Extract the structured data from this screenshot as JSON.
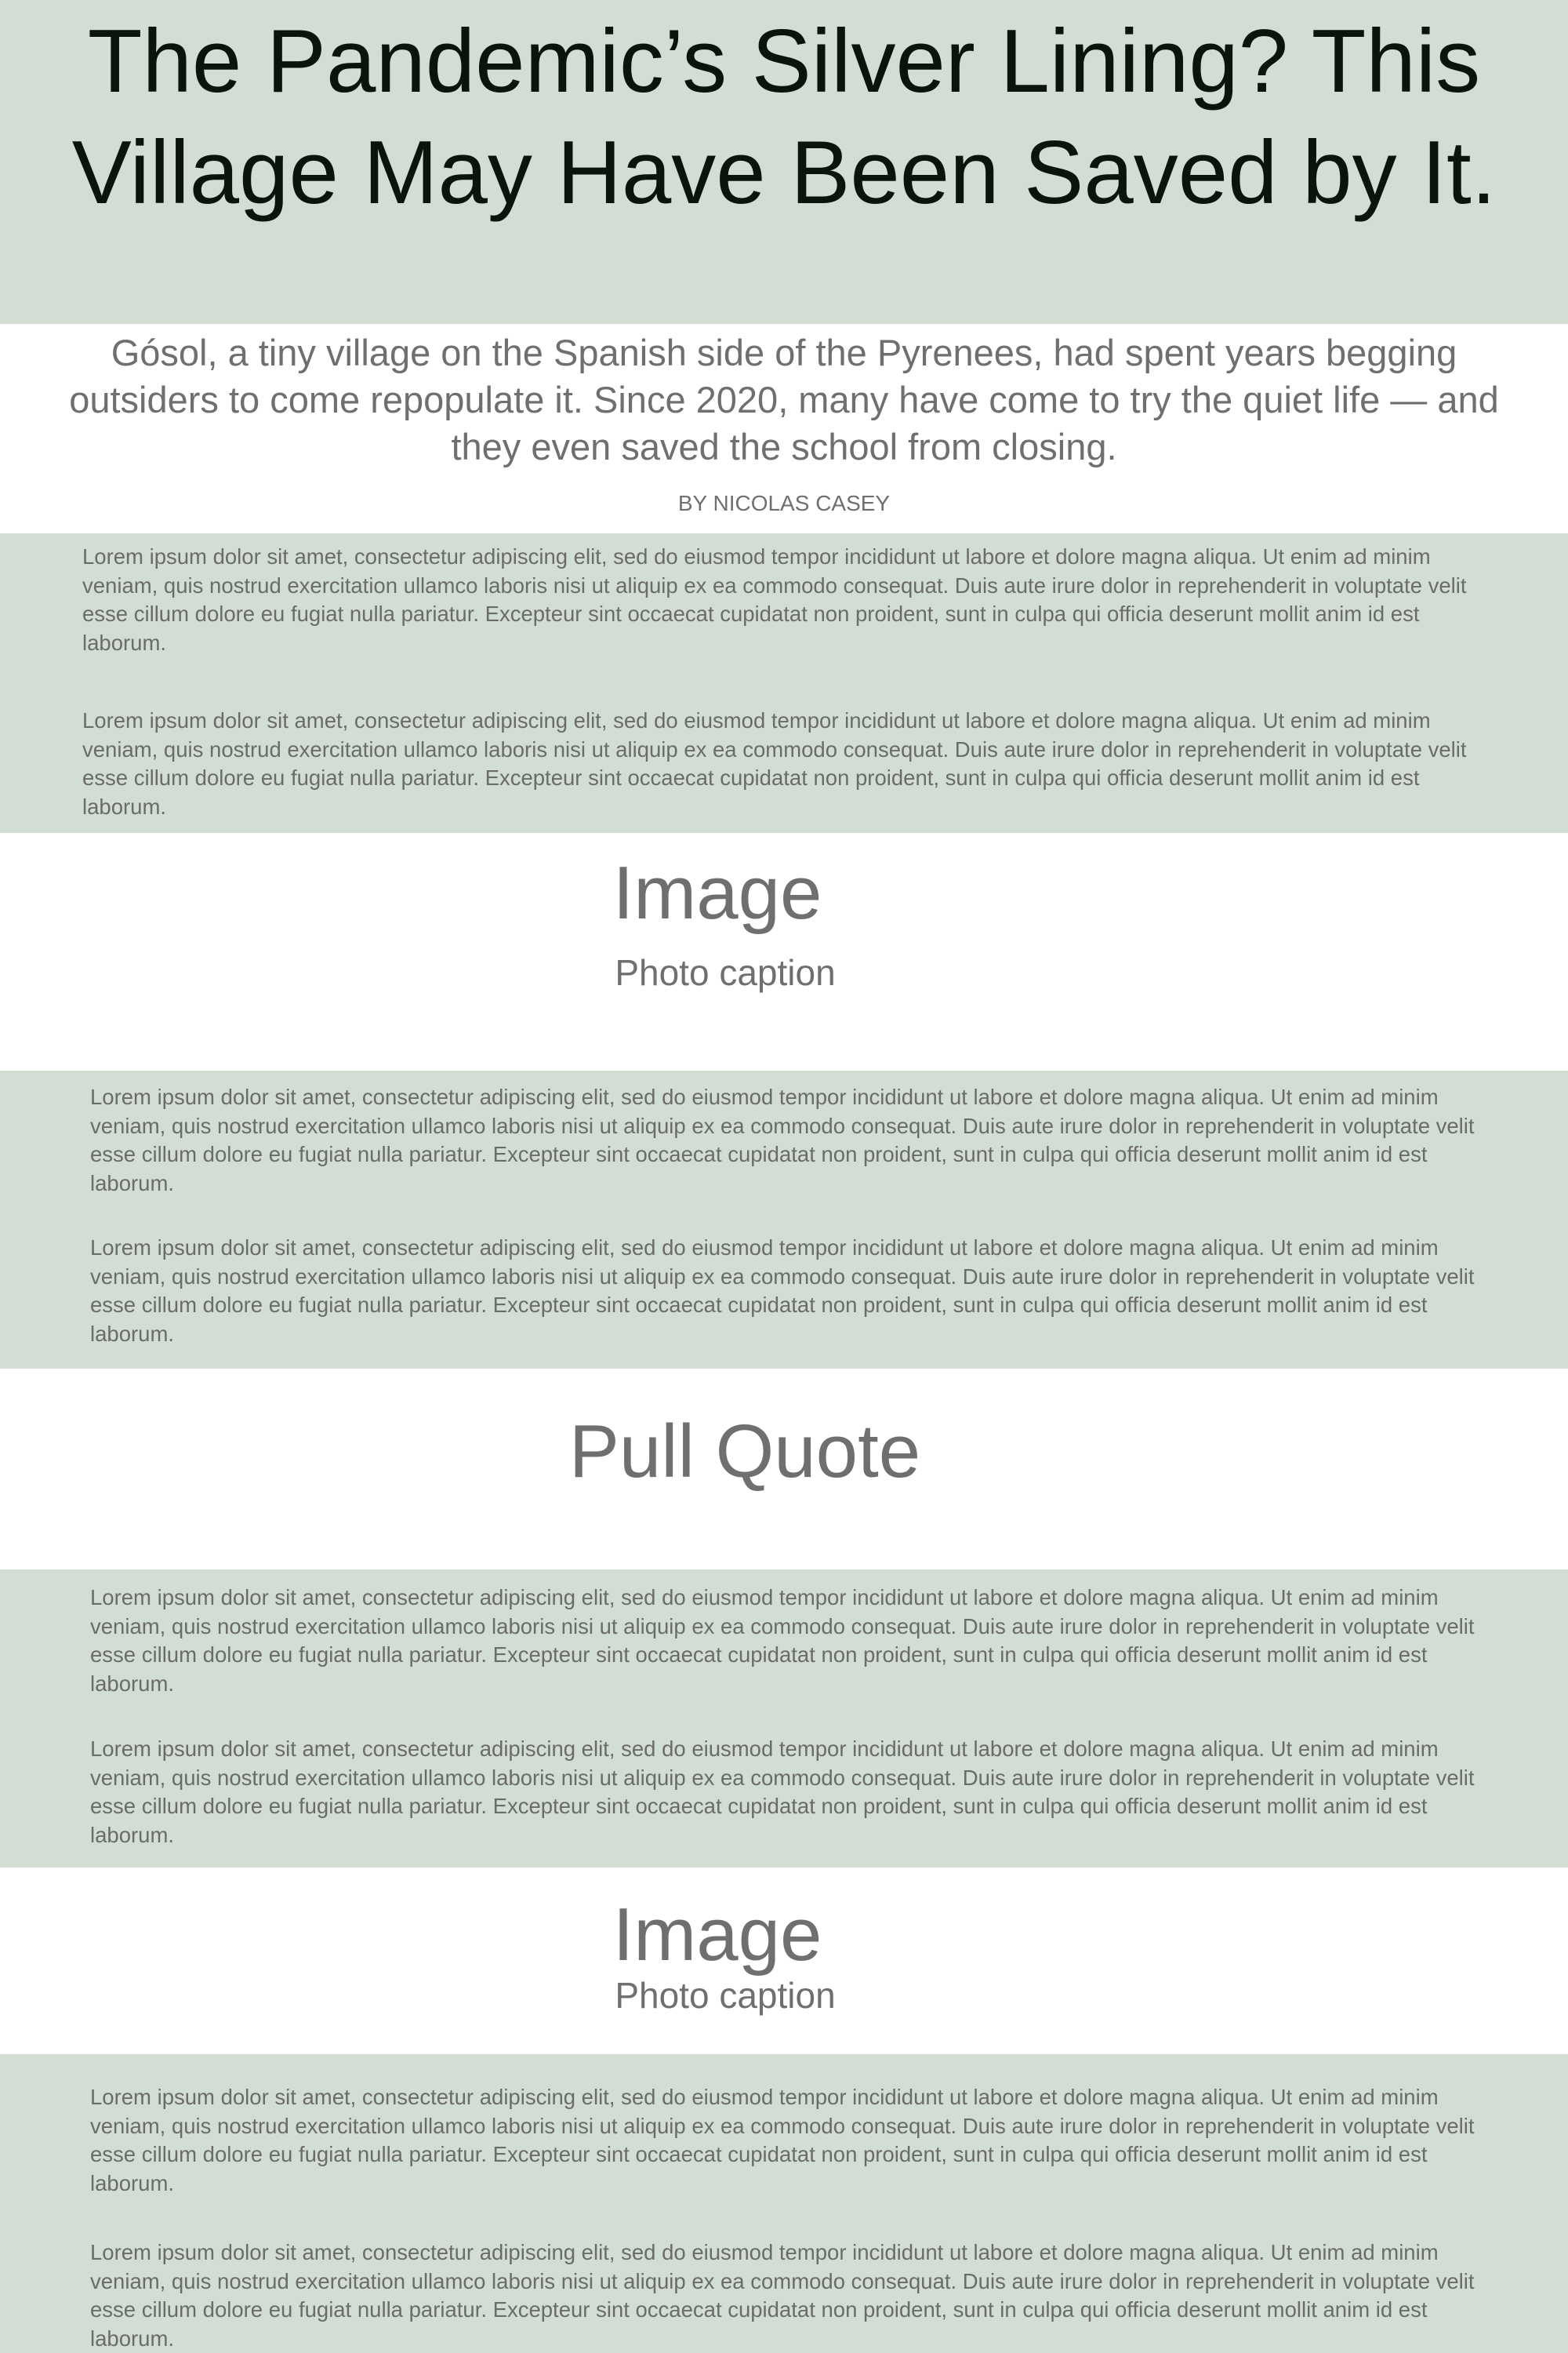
{
  "headline": {
    "title": "The Pandemic’s Silver Lining? This Village May Have Been Saved by It.",
    "subtitle": "Gósol, a tiny village on the Spanish side of the Pyrenees, had spent years begging outsiders to come repopulate it. Since 2020, many have come to try the quiet life — and they even saved the school from closing.",
    "byline": "BY NICOLAS CASEY"
  },
  "sections": [
    {
      "paragraphs": [
        "Lorem ipsum dolor sit amet, consectetur adipiscing elit, sed do eiusmod tempor incididunt ut labore et dolore magna aliqua. Ut enim ad minim veniam, quis nostrud exercitation ullamco laboris nisi ut aliquip ex ea commodo consequat. Duis aute irure dolor in reprehenderit in voluptate velit esse cillum dolore eu fugiat nulla pariatur. Excepteur sint occaecat cupidatat non proident, sunt in culpa qui officia deserunt mollit anim id est laborum.",
        "Lorem ipsum dolor sit amet, consectetur adipiscing elit, sed do eiusmod tempor incididunt ut labore et dolore magna aliqua. Ut enim ad minim veniam, quis nostrud exercitation ullamco laboris nisi ut aliquip ex ea commodo consequat. Duis aute irure dolor in reprehenderit in voluptate velit esse cillum dolore eu fugiat nulla pariatur. Excepteur sint occaecat cupidatat non proident, sunt in culpa qui officia deserunt mollit anim id est laborum."
      ]
    },
    {
      "paragraphs": [
        "Lorem ipsum dolor sit amet, consectetur adipiscing elit, sed do eiusmod tempor incididunt ut labore et dolore magna aliqua. Ut enim ad minim veniam, quis nostrud exercitation ullamco laboris nisi ut aliquip ex ea commodo consequat. Duis aute irure dolor in reprehenderit in voluptate velit esse cillum dolore eu fugiat nulla pariatur. Excepteur sint occaecat cupidatat non proident, sunt in culpa qui officia deserunt mollit anim id est laborum.",
        "Lorem ipsum dolor sit amet, consectetur adipiscing elit, sed do eiusmod tempor incididunt ut labore et dolore magna aliqua. Ut enim ad minim veniam, quis nostrud exercitation ullamco laboris nisi ut aliquip ex ea commodo consequat. Duis aute irure dolor in reprehenderit in voluptate velit esse cillum dolore eu fugiat nulla pariatur. Excepteur sint occaecat cupidatat non proident, sunt in culpa qui officia deserunt mollit anim id est laborum."
      ]
    },
    {
      "paragraphs": [
        "Lorem ipsum dolor sit amet, consectetur adipiscing elit, sed do eiusmod tempor incididunt ut labore et dolore magna aliqua. Ut enim ad minim veniam, quis nostrud exercitation ullamco laboris nisi ut aliquip ex ea commodo consequat. Duis aute irure dolor in reprehenderit in voluptate velit esse cillum dolore eu fugiat nulla pariatur. Excepteur sint occaecat cupidatat non proident, sunt in culpa qui officia deserunt mollit anim id est laborum.",
        "Lorem ipsum dolor sit amet, consectetur adipiscing elit, sed do eiusmod tempor incididunt ut labore et dolore magna aliqua. Ut enim ad minim veniam, quis nostrud exercitation ullamco laboris nisi ut aliquip ex ea commodo consequat. Duis aute irure dolor in reprehenderit in voluptate velit esse cillum dolore eu fugiat nulla pariatur. Excepteur sint occaecat cupidatat non proident, sunt in culpa qui officia deserunt mollit anim id est laborum."
      ]
    },
    {
      "paragraphs": [
        "Lorem ipsum dolor sit amet, consectetur adipiscing elit, sed do eiusmod tempor incididunt ut labore et dolore magna aliqua. Ut enim ad minim veniam, quis nostrud exercitation ullamco laboris nisi ut aliquip ex ea commodo consequat. Duis aute irure dolor in reprehenderit in voluptate velit esse cillum dolore eu fugiat nulla pariatur. Excepteur sint occaecat cupidatat non proident, sunt in culpa qui officia deserunt mollit anim id est laborum.",
        "Lorem ipsum dolor sit amet, consectetur adipiscing elit, sed do eiusmod tempor incididunt ut labore et dolore magna aliqua. Ut enim ad minim veniam, quis nostrud exercitation ullamco laboris nisi ut aliquip ex ea commodo consequat. Duis aute irure dolor in reprehenderit in voluptate velit esse cillum dolore eu fugiat nulla pariatur. Excepteur sint occaecat cupidatat non proident, sunt in culpa qui officia deserunt mollit anim id est laborum."
      ]
    }
  ],
  "figures": [
    {
      "placeholder": "Image",
      "caption": "Photo caption"
    },
    {
      "placeholder": "Image",
      "caption": "Photo caption"
    }
  ],
  "pull_quote": "Pull Quote",
  "colors": {
    "band_background": "#d2ddd4",
    "title_text": "#0b140b",
    "body_text": "#6b6b6b"
  }
}
